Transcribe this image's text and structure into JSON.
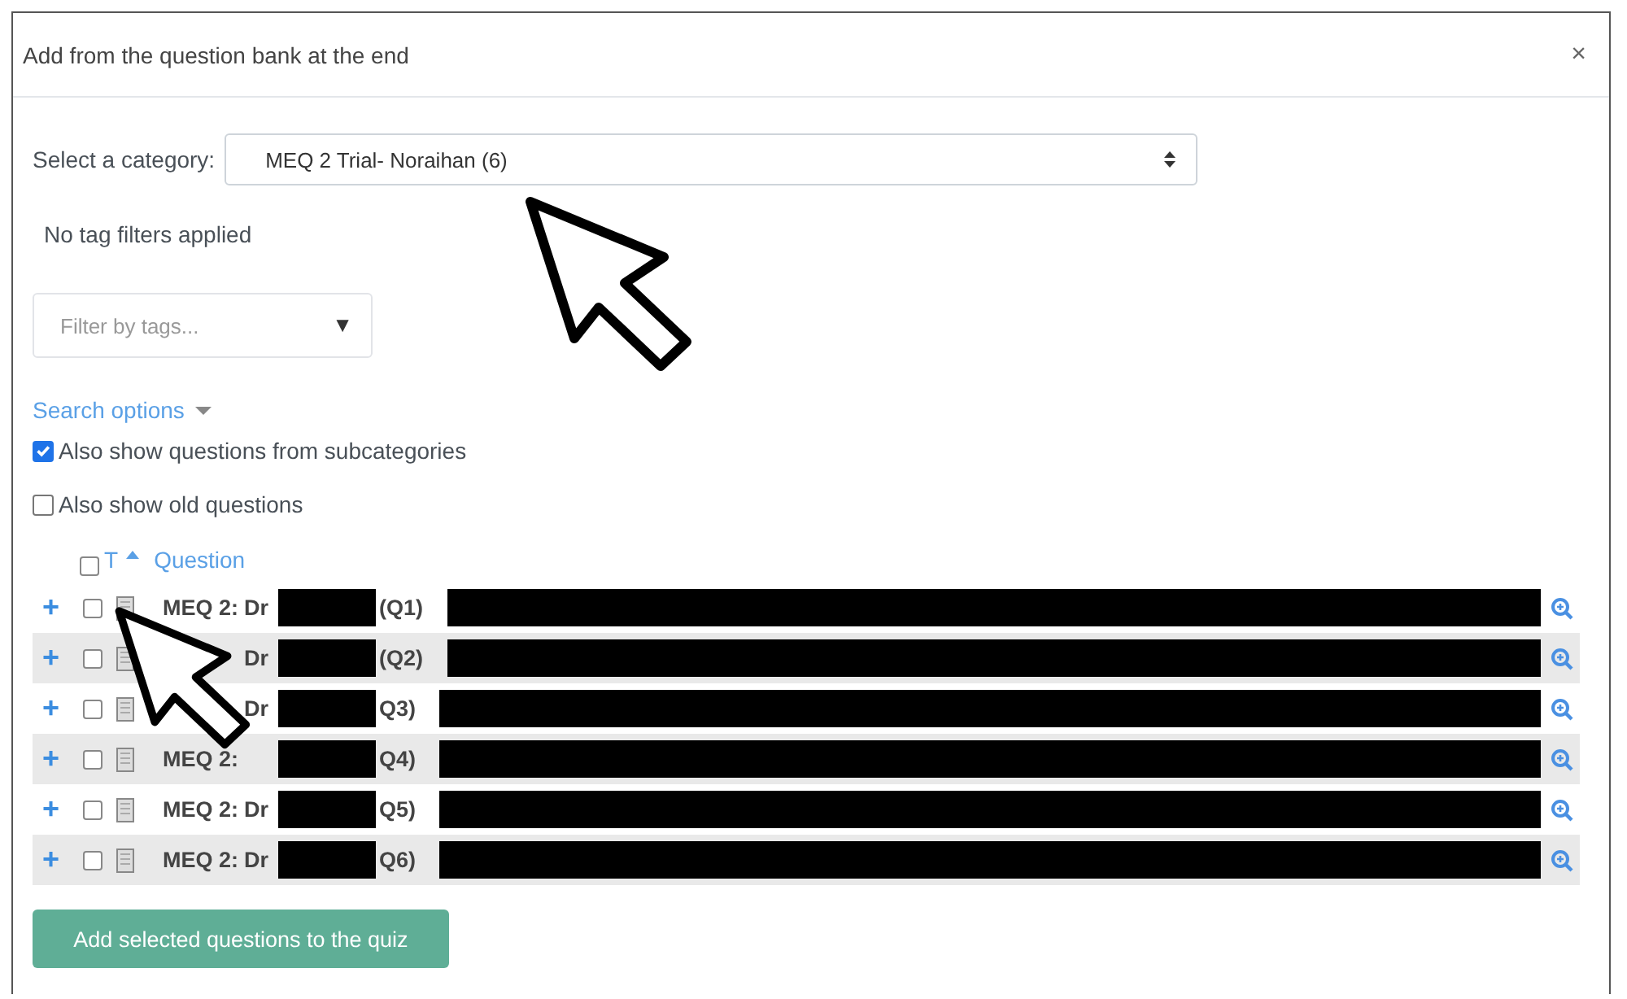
{
  "dialog": {
    "title": "Add from the question bank at the end",
    "close": "×"
  },
  "category": {
    "label": "Select a category:",
    "value": "MEQ 2 Trial- Noraihan (6)"
  },
  "tag_status": "No tag filters applied",
  "tag_filter": {
    "placeholder": "Filter by tags...",
    "caret": "▼"
  },
  "search_options": {
    "label": "Search options",
    "expanded": false
  },
  "options": [
    {
      "label": "Also show questions from subcategories",
      "checked": true
    },
    {
      "label": "Also show old questions",
      "checked": false
    }
  ],
  "table": {
    "select_all": false,
    "columns": [
      {
        "label": "T",
        "sorted": true
      },
      {
        "label": "Question",
        "sorted": false
      }
    ],
    "rows": [
      {
        "add": "+",
        "checked": false,
        "code": "MEQ 2:",
        "title": "Dr",
        "number": "(Q1)"
      },
      {
        "add": "+",
        "checked": false,
        "title": "Dr",
        "number": "(Q2)"
      },
      {
        "add": "+",
        "checked": false,
        "title": "Dr",
        "number": "Q3)"
      },
      {
        "add": "+",
        "checked": false,
        "code": "MEQ 2:",
        "number": "Q4)"
      },
      {
        "add": "+",
        "checked": false,
        "code": "MEQ 2:",
        "title": "Dr",
        "number": "Q5)"
      },
      {
        "add": "+",
        "checked": false,
        "code": "MEQ 2:",
        "title": "Dr",
        "number": "Q6)"
      }
    ]
  },
  "submit": "Add selected questions to the quiz"
}
